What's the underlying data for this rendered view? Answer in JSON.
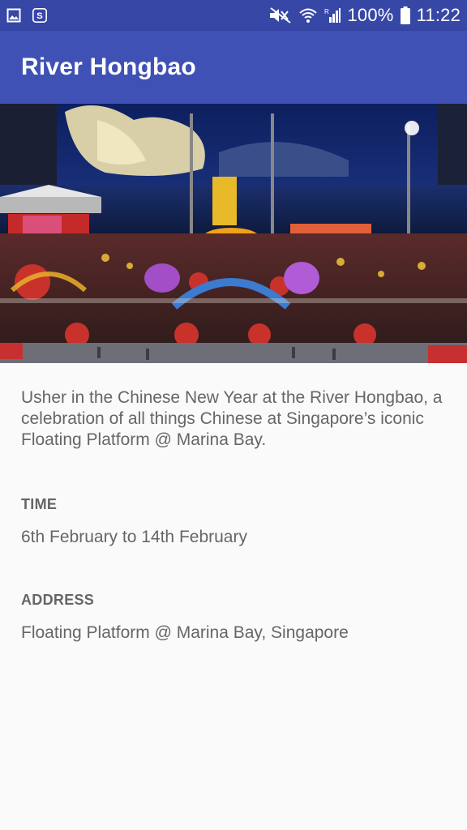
{
  "status_bar": {
    "battery": "100%",
    "time": "11:22",
    "icons": [
      "image-icon",
      "s-app-icon",
      "mute-icon",
      "wifi-icon",
      "signal-icon",
      "battery-icon"
    ]
  },
  "app_bar": {
    "title": "River Hongbao",
    "color": "#3f51b5"
  },
  "hero_image": {
    "subject": "river-hongbao-photo"
  },
  "content": {
    "description": "Usher in the Chinese New Year at the River Hongbao, a celebration of all things Chinese at Singapore’s iconic Floating Platform @ Marina Bay.",
    "time_label": "TIME",
    "time_value": "6th February to 14th February",
    "address_label": "ADDRESS",
    "address_value": "Floating Platform @ Marina Bay, Singapore"
  }
}
